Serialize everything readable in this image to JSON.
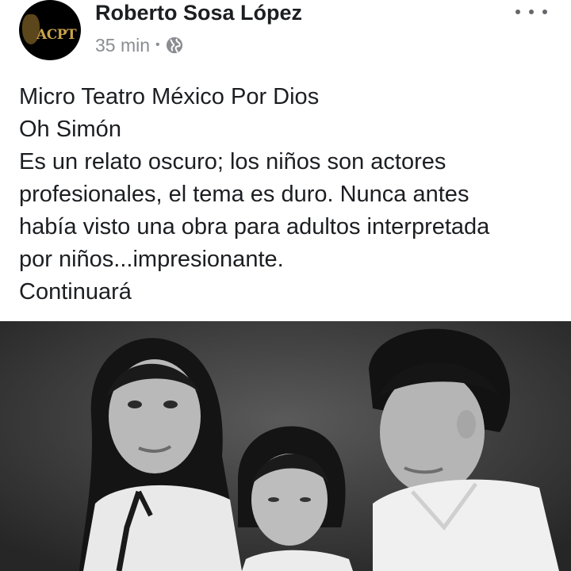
{
  "post": {
    "avatar": {
      "logo_text": "ACPT",
      "logo_color": "#c9a24a"
    },
    "author": "Roberto Sosa López",
    "time": "35 min",
    "separator": "•",
    "privacy_icon": "globe-icon",
    "more_icon": "more-horizontal-icon",
    "text_lines": [
      "Micro Teatro México Por Dios",
      "Oh Simón",
      "Es un relato oscuro; los niños son actores",
      "profesionales, el tema es duro. Nunca antes",
      "había visto una obra para adultos interpretada",
      "por niños...impresionante.",
      "Continuará"
    ]
  },
  "photo": {
    "style": "black-and-white",
    "subject": "three children in white school shirts"
  }
}
